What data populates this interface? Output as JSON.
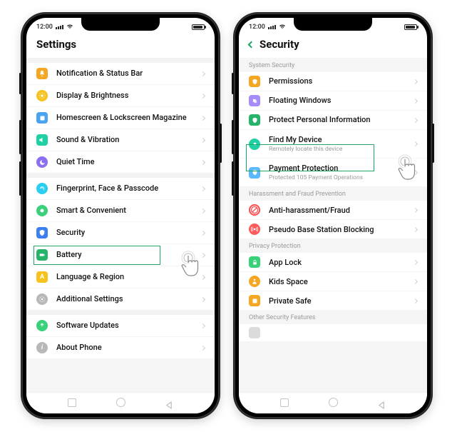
{
  "status": {
    "time": "12:00"
  },
  "phone1": {
    "title": "Settings",
    "items": [
      {
        "label": "Notification & Status Bar"
      },
      {
        "label": "Display & Brightness"
      },
      {
        "label": "Homescreen & Lockscreen Magazine"
      },
      {
        "label": "Sound & Vibration"
      },
      {
        "label": "Quiet Time"
      },
      {
        "label": "Fingerprint, Face & Passcode"
      },
      {
        "label": "Smart & Convenient"
      },
      {
        "label": "Security"
      },
      {
        "label": "Battery"
      },
      {
        "label": "Language & Region"
      },
      {
        "label": "Additional Settings"
      },
      {
        "label": "Software Updates"
      },
      {
        "label": "About Phone"
      }
    ]
  },
  "phone2": {
    "title": "Security",
    "sections": {
      "system": "System Security",
      "harassment": "Harassment and Fraud Prevention",
      "privacy": "Privacy Protection",
      "other": "Other Security Features"
    },
    "items": {
      "permissions": {
        "label": "Permissions"
      },
      "floating": {
        "label": "Floating Windows"
      },
      "protect": {
        "label": "Protect Personal Information"
      },
      "findmy": {
        "label": "Find My Device",
        "sub": "Remotely locate this device"
      },
      "payment": {
        "label": "Payment Protection",
        "sub": "Protected 105 Payment Operations"
      },
      "antih": {
        "label": "Anti-harassment/Fraud"
      },
      "pseudo": {
        "label": "Pseudo Base Station Blocking"
      },
      "applock": {
        "label": "App Lock"
      },
      "kids": {
        "label": "Kids Space"
      },
      "psafe": {
        "label": "Private Safe"
      }
    }
  }
}
